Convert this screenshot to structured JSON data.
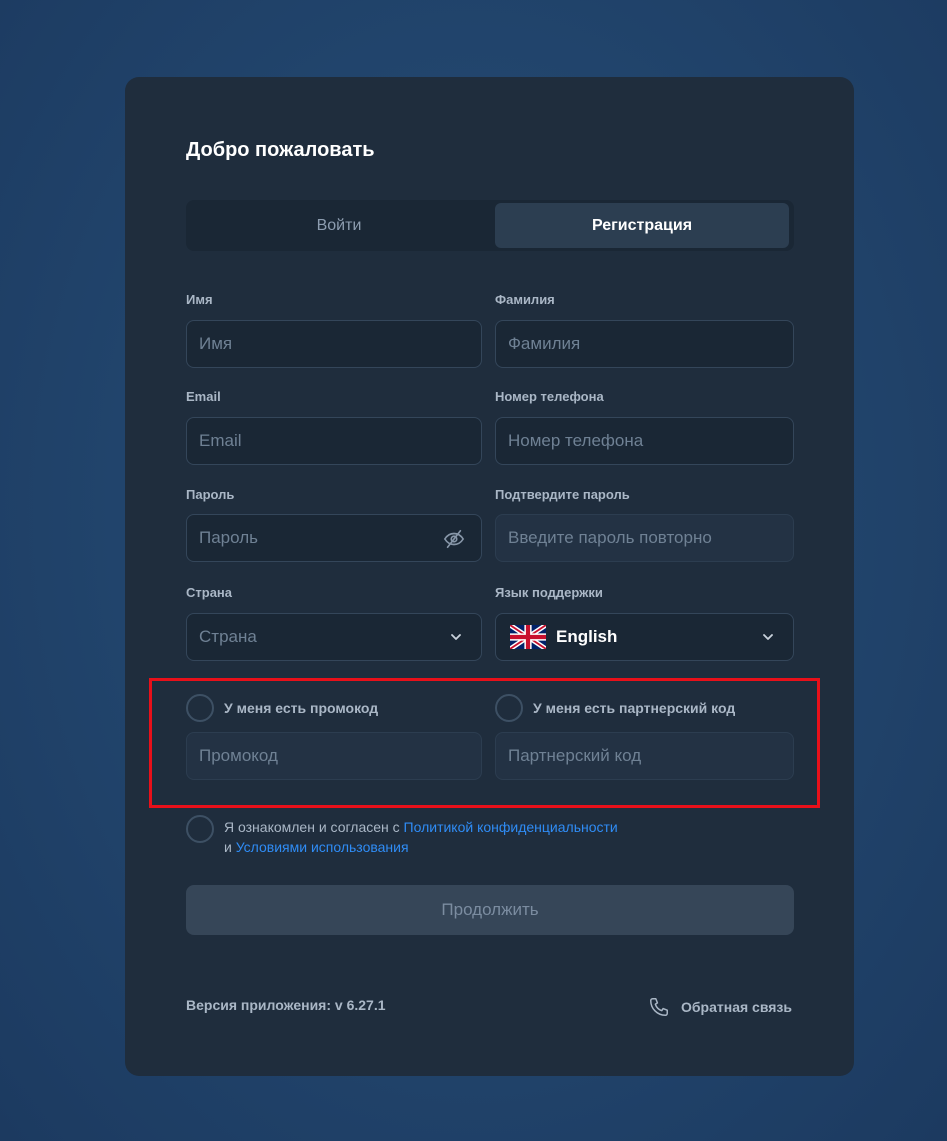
{
  "title": "Добро пожаловать",
  "tabs": {
    "login": "Войти",
    "register": "Регистрация"
  },
  "form": {
    "first_name": {
      "label": "Имя",
      "placeholder": "Имя"
    },
    "last_name": {
      "label": "Фамилия",
      "placeholder": "Фамилия"
    },
    "email": {
      "label": "Email",
      "placeholder": "Email"
    },
    "phone": {
      "label": "Номер телефона",
      "placeholder": "Номер телефона"
    },
    "password": {
      "label": "Пароль",
      "placeholder": "Пароль"
    },
    "confirm_password": {
      "label": "Подтвердите пароль",
      "placeholder": "Введите пароль повторно"
    },
    "country": {
      "label": "Страна",
      "placeholder": "Страна"
    },
    "support_language": {
      "label": "Язык поддержки",
      "value": "English"
    },
    "promo": {
      "checkbox_label": "У меня есть промокод",
      "placeholder": "Промокод"
    },
    "partner": {
      "checkbox_label": "У меня есть партнерский код",
      "placeholder": "Партнерский код"
    }
  },
  "agreement": {
    "text_before": "Я ознакомлен и согласен с ",
    "privacy_link": "Политикой конфиденциальности",
    "text_and": "и ",
    "terms_link": "Условиями использования"
  },
  "continue_label": "Продолжить",
  "footer": {
    "version": "Версия приложения: v 6.27.1",
    "feedback": "Обратная связь"
  },
  "colors": {
    "card": "#1f2d3d",
    "accent_link": "#2f8cf5",
    "highlight": "#e8101a"
  }
}
